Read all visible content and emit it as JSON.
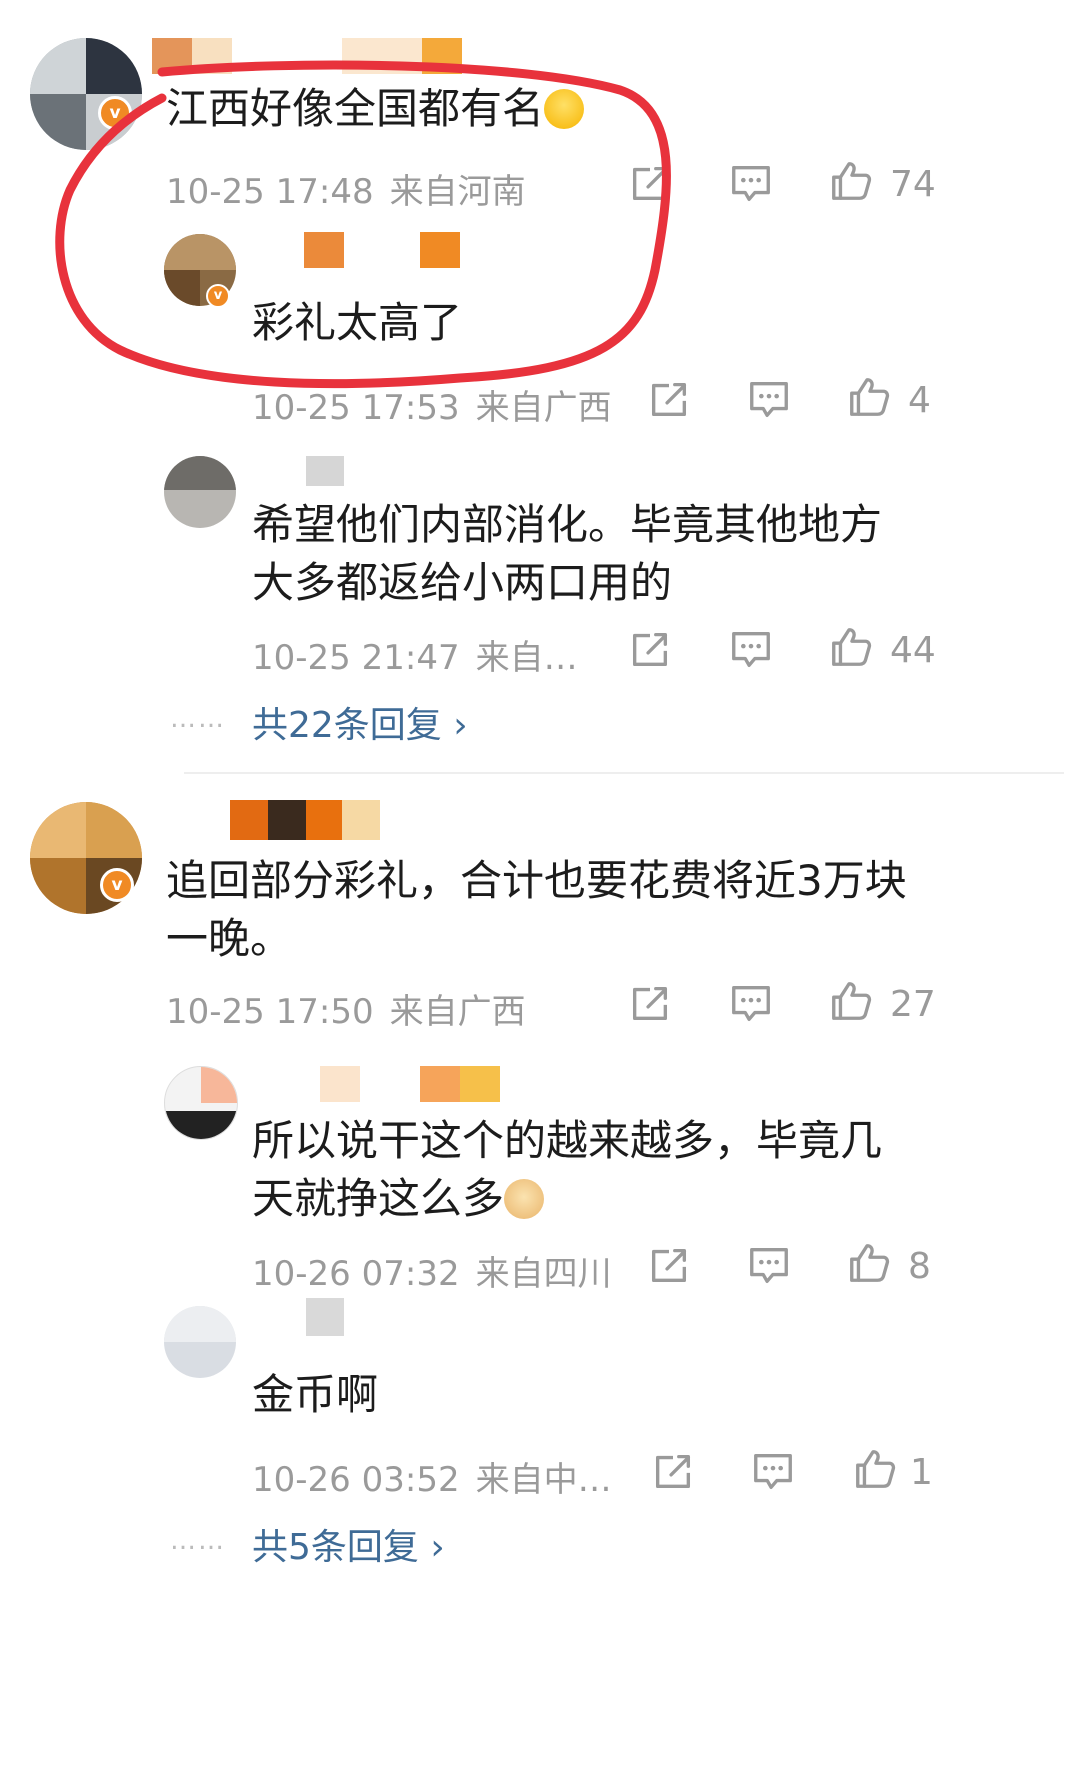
{
  "comments": [
    {
      "text": "江西好像全国都有名",
      "emoji": "crying-laughing-emoji",
      "time": "10-25 17:48",
      "source": "来自河南",
      "likes": "74",
      "replies": [
        {
          "text": "彩礼太高了",
          "time": "10-25 17:53",
          "source": "来自广西",
          "likes": "4"
        },
        {
          "text": "希望他们内部消化。毕竟其他地方大多都返给小两口用的",
          "time": "10-25 21:47",
          "source": "来自…",
          "likes": "44"
        }
      ],
      "more_dots": "……",
      "more_replies": "共22条回复 ›"
    },
    {
      "text": "追回部分彩礼，合计也要花费将近3万块一晚。",
      "time": "10-25 17:50",
      "source": "来自广西",
      "likes": "27",
      "replies": [
        {
          "text": "所以说干这个的越来越多，毕竟几天就挣这么多",
          "emoji": "doge-emoji",
          "time": "10-26 07:32",
          "source": "来自四川",
          "likes": "8"
        },
        {
          "text": "金币啊",
          "time": "10-26 03:52",
          "source": "来自中…",
          "likes": "1"
        }
      ],
      "more_dots": "……",
      "more_replies": "共5条回复 ›"
    }
  ],
  "colors": {
    "annotation": "#e8323c",
    "link": "#3f6b96",
    "meta": "#9a9a9a",
    "verified": "#f08a24"
  },
  "icons": {
    "share": "share-icon",
    "comment": "comment-icon",
    "like": "thumbs-up-icon"
  }
}
